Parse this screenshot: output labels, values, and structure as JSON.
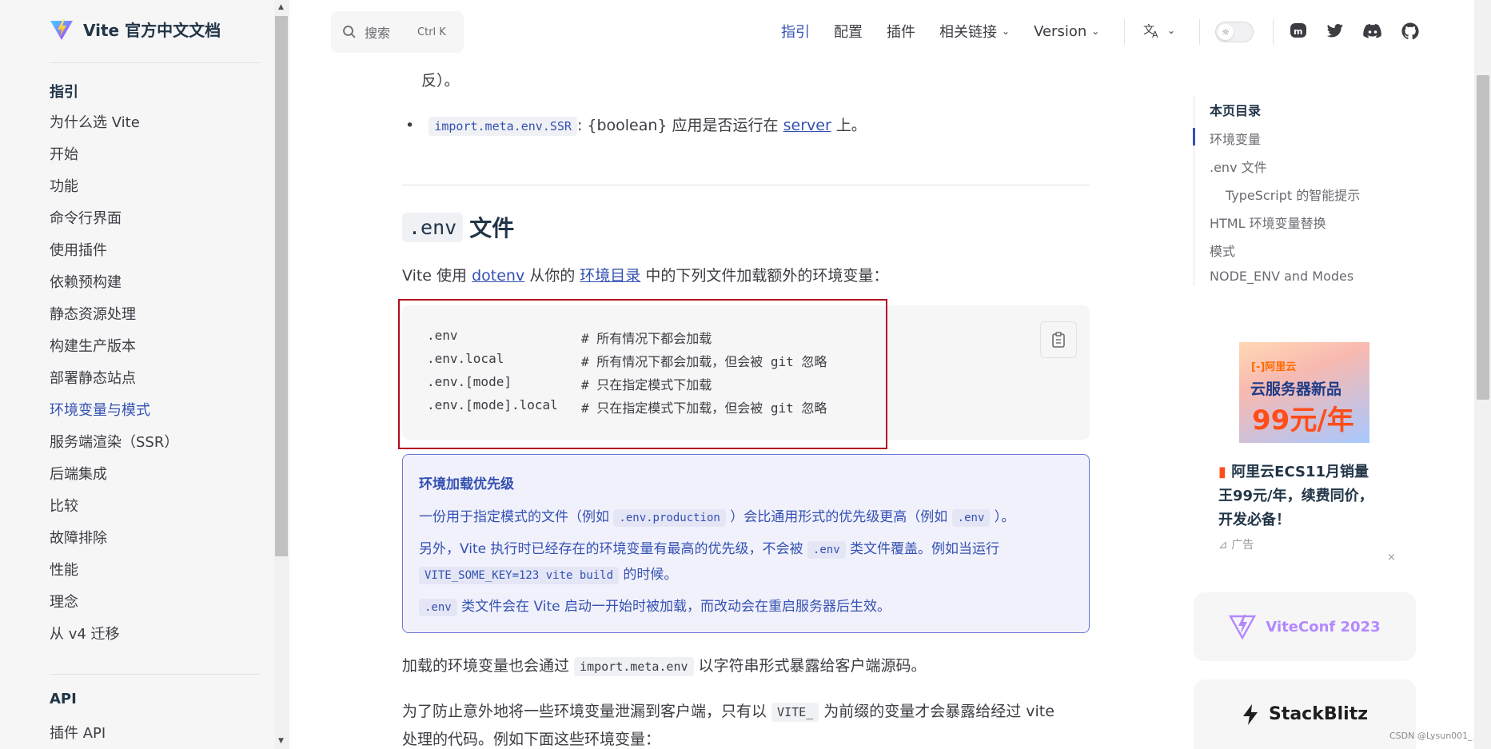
{
  "sidebar": {
    "brand": "Vite 官方中文文档",
    "section_guide": "指引",
    "items": [
      "为什么选 Vite",
      "开始",
      "功能",
      "命令行界面",
      "使用插件",
      "依赖预构建",
      "静态资源处理",
      "构建生产版本",
      "部署静态站点",
      "环境变量与模式",
      "服务端渲染（SSR）",
      "后端集成",
      "比较",
      "故障排除",
      "性能",
      "理念",
      "从 v4 迁移"
    ],
    "active_item": "环境变量与模式",
    "section_api": "API",
    "api_first": "插件 API"
  },
  "search": {
    "placeholder": "搜索",
    "shortcut": "Ctrl K"
  },
  "nav": {
    "items": [
      "指引",
      "配置",
      "插件",
      "相关链接",
      "Version"
    ],
    "active": "指引"
  },
  "content": {
    "top_fragment": "反）。",
    "ssr_code": "import.meta.env.SSR",
    "ssr_text": ": {boolean} 应用是否运行在 ",
    "ssr_link": "server",
    "ssr_end": " 上。",
    "heading_code": ".env",
    "heading_text": "文件",
    "intro_1": "Vite 使用 ",
    "intro_link1": "dotenv",
    "intro_2": " 从你的 ",
    "intro_link2": "环境目录",
    "intro_3": " 中的下列文件加载额外的环境变量：",
    "code_lines": [
      {
        "file": ".env",
        "comment": "# 所有情况下都会加载"
      },
      {
        "file": ".env.local",
        "comment": "# 所有情况下都会加载，但会被 git 忽略"
      },
      {
        "file": ".env.[mode]",
        "comment": "# 只在指定模式下加载"
      },
      {
        "file": ".env.[mode].local",
        "comment": "# 只在指定模式下加载，但会被 git 忽略"
      }
    ],
    "tip": {
      "title": "环境加载优先级",
      "l1a": "一份用于指定模式的文件（例如 ",
      "l1code1": ".env.production",
      "l1b": " ）会比通用形式的优先级更高（例如 ",
      "l1code2": ".env",
      "l1c": " ）。",
      "l2a": "另外，Vite 执行时已经存在的环境变量有最高的优先级，不会被 ",
      "l2code": ".env",
      "l2b": " 类文件覆盖。例如当运行",
      "l3code": "VITE_SOME_KEY=123 vite build",
      "l3b": " 的时候。",
      "l4code": ".env",
      "l4b": " 类文件会在 Vite 启动一开始时被加载，而改动会在重启服务器后生效。"
    },
    "p_expose_a": "加载的环境变量也会通过 ",
    "p_expose_code": "import.meta.env",
    "p_expose_b": " 以字符串形式暴露给客户端源码。",
    "p_prevent_a": "为了防止意外地将一些环境变量泄漏到客户端，只有以 ",
    "p_prevent_code": "VITE_",
    "p_prevent_b": " 为前缀的变量才会暴露给经过 vite",
    "p_prevent_c": "处理的代码。例如下面这些环境变量："
  },
  "toc": {
    "title": "本页目录",
    "items": [
      "环境变量",
      ".env 文件",
      "TypeScript 的智能提示",
      "HTML 环境变量替换",
      "模式",
      "NODE_ENV and Modes"
    ]
  },
  "ad": {
    "logo": "[-]阿里云",
    "line1": "云服务器新品",
    "line2": "99元/年",
    "text": "阿里云ECS11月销量王99元/年，续费同价，开发必备！",
    "tag": "广告",
    "close": "×"
  },
  "sponsors": {
    "viteconf": "ViteConf 2023",
    "stackblitz": "StackBlitz"
  },
  "watermark": "CSDN @Lysun001_",
  "colors": {
    "brand": "#3451b2",
    "annotation": "#b00d1f"
  }
}
